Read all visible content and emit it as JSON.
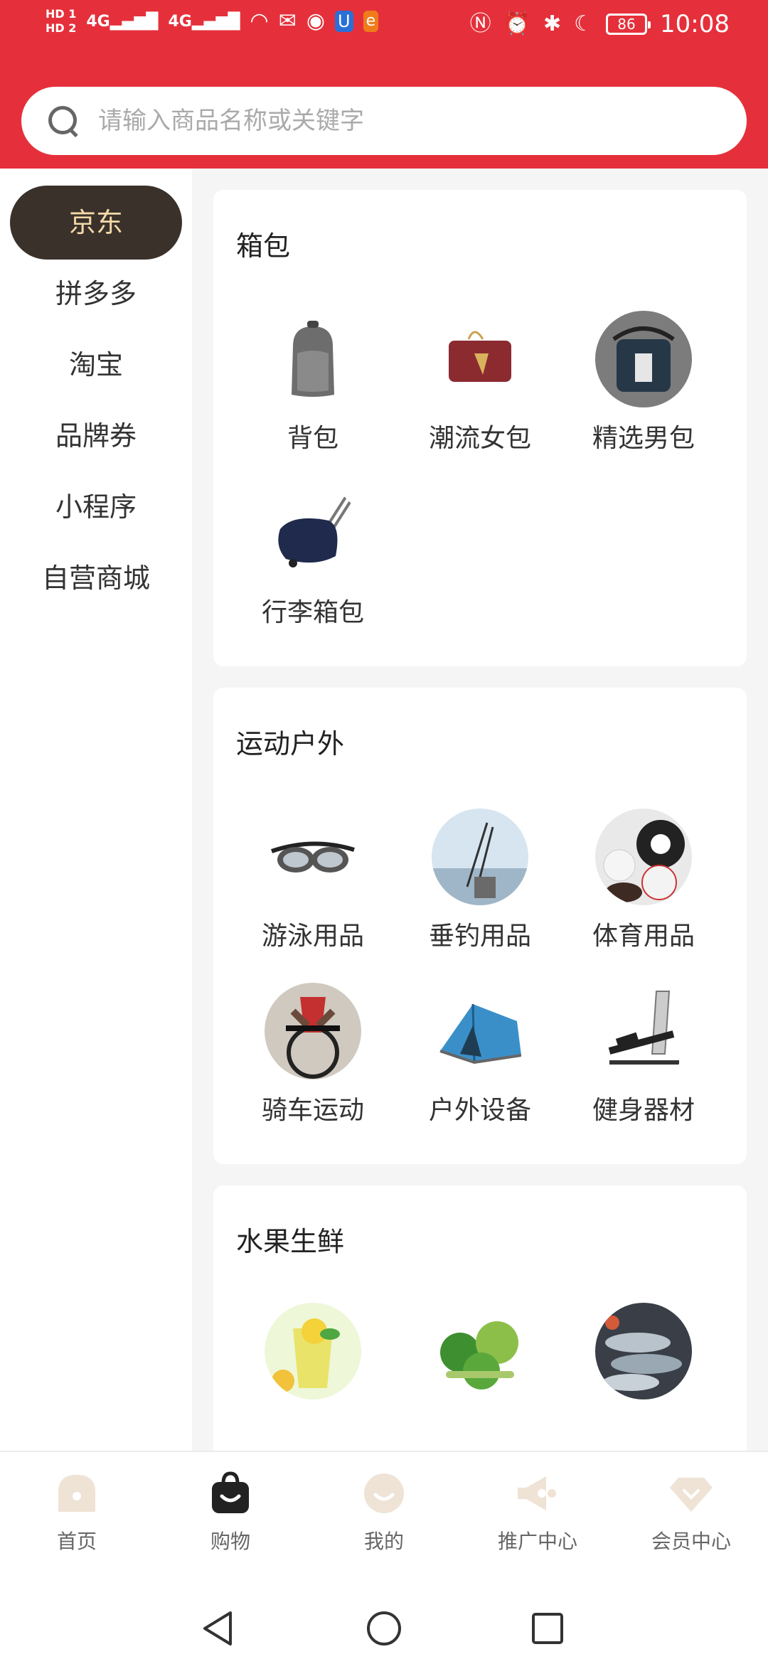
{
  "status_bar": {
    "hd1": "HD 1",
    "hd2": "HD 2",
    "signal1": "4G",
    "signal2": "4G",
    "battery": "86",
    "time": "10:08"
  },
  "search": {
    "placeholder": "请输入商品名称或关键字"
  },
  "sidebar": {
    "items": [
      {
        "label": "京东",
        "active": true
      },
      {
        "label": "拼多多"
      },
      {
        "label": "淘宝"
      },
      {
        "label": "品牌券"
      },
      {
        "label": "小程序"
      },
      {
        "label": "自营商城"
      }
    ]
  },
  "categories": [
    {
      "title": "箱包",
      "items": [
        {
          "label": "背包",
          "icon": "backpack-icon"
        },
        {
          "label": "潮流女包",
          "icon": "handbag-icon"
        },
        {
          "label": "精选男包",
          "icon": "mens-bag-icon"
        },
        {
          "label": "行李箱包",
          "icon": "luggage-icon"
        }
      ]
    },
    {
      "title": "运动户外",
      "items": [
        {
          "label": "游泳用品",
          "icon": "goggles-icon"
        },
        {
          "label": "垂钓用品",
          "icon": "fishing-icon"
        },
        {
          "label": "体育用品",
          "icon": "sports-balls-icon"
        },
        {
          "label": "骑车运动",
          "icon": "cycling-icon"
        },
        {
          "label": "户外设备",
          "icon": "tent-icon"
        },
        {
          "label": "健身器材",
          "icon": "fitness-machine-icon"
        }
      ]
    },
    {
      "title": "水果生鲜",
      "items": [
        {
          "label": "",
          "icon": "juice-icon"
        },
        {
          "label": "",
          "icon": "vegetables-icon"
        },
        {
          "label": "",
          "icon": "seafood-icon"
        }
      ]
    }
  ],
  "bottom_nav": {
    "items": [
      {
        "label": "首页",
        "icon": "home-icon"
      },
      {
        "label": "购物",
        "icon": "shopping-bag-icon",
        "active": true
      },
      {
        "label": "我的",
        "icon": "profile-icon"
      },
      {
        "label": "推广中心",
        "icon": "megaphone-icon"
      },
      {
        "label": "会员中心",
        "icon": "diamond-icon"
      }
    ]
  },
  "colors": {
    "brand_red": "#e5303b",
    "active_bg": "#3a312b",
    "active_text": "#f3d9a8",
    "nav_icon_inactive": "#efe3d6"
  }
}
